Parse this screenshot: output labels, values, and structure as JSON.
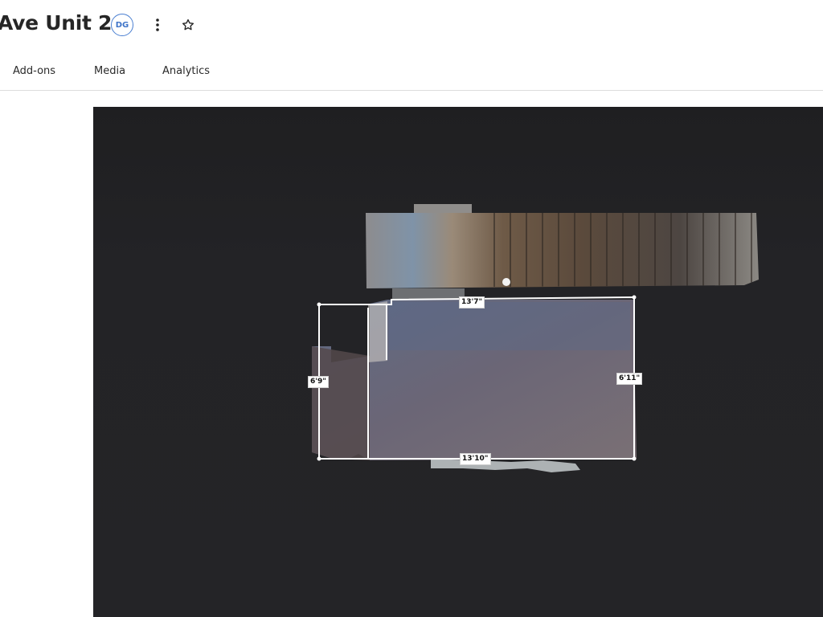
{
  "header": {
    "title": "Ave Unit 2",
    "avatar_initials": "DG",
    "more_icon": "kebab-vertical-icon",
    "favorite_icon": "star-outline-icon"
  },
  "tabs": [
    {
      "label": "Add-ons"
    },
    {
      "label": "Media"
    },
    {
      "label": "Analytics"
    }
  ],
  "floorplan": {
    "dimensions": {
      "top": "13'7\"",
      "bottom": "13'10\"",
      "left": "6'9\"",
      "right": "6'11\""
    }
  },
  "colors": {
    "viewer_background": "#242427",
    "avatar_accent": "#3f74c8",
    "measurement_line": "#ffffff"
  }
}
